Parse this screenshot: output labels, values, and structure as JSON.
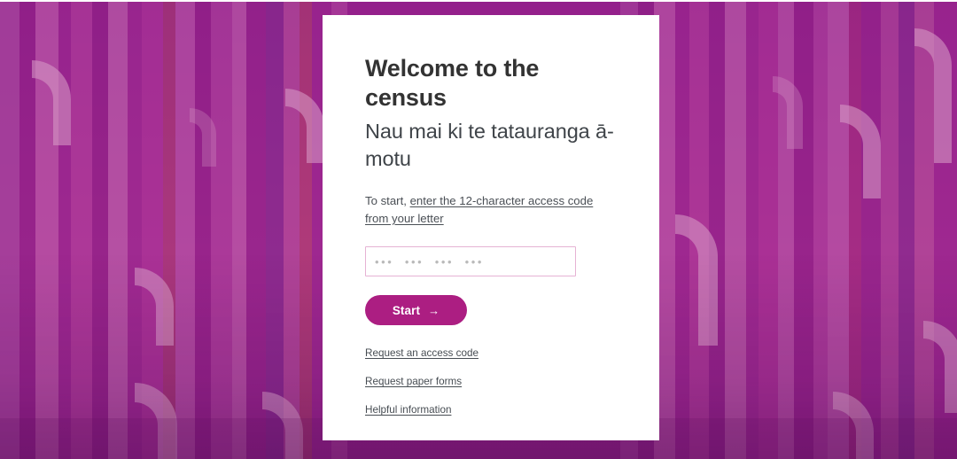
{
  "page": {
    "background_base_color": "#9B2490",
    "card_background": "#ffffff"
  },
  "card": {
    "title": "Welcome to the census",
    "subtitle": "Nau mai ki te tatauranga ā-motu",
    "instruction": {
      "lead_text": "To start, ",
      "link_text": "enter the 12-character access code from your letter"
    },
    "access_code_input": {
      "value": "",
      "placeholder": "•••  •••  •••  •••",
      "border_color": "#e6b3d4"
    },
    "start_button": {
      "label": "Start",
      "arrow_glyph": "→",
      "background_color": "#ac1e82",
      "text_color": "#ffffff"
    },
    "links": [
      {
        "label": "Request an access code"
      },
      {
        "label": "Request paper forms"
      },
      {
        "label": "Helpful information"
      }
    ]
  }
}
